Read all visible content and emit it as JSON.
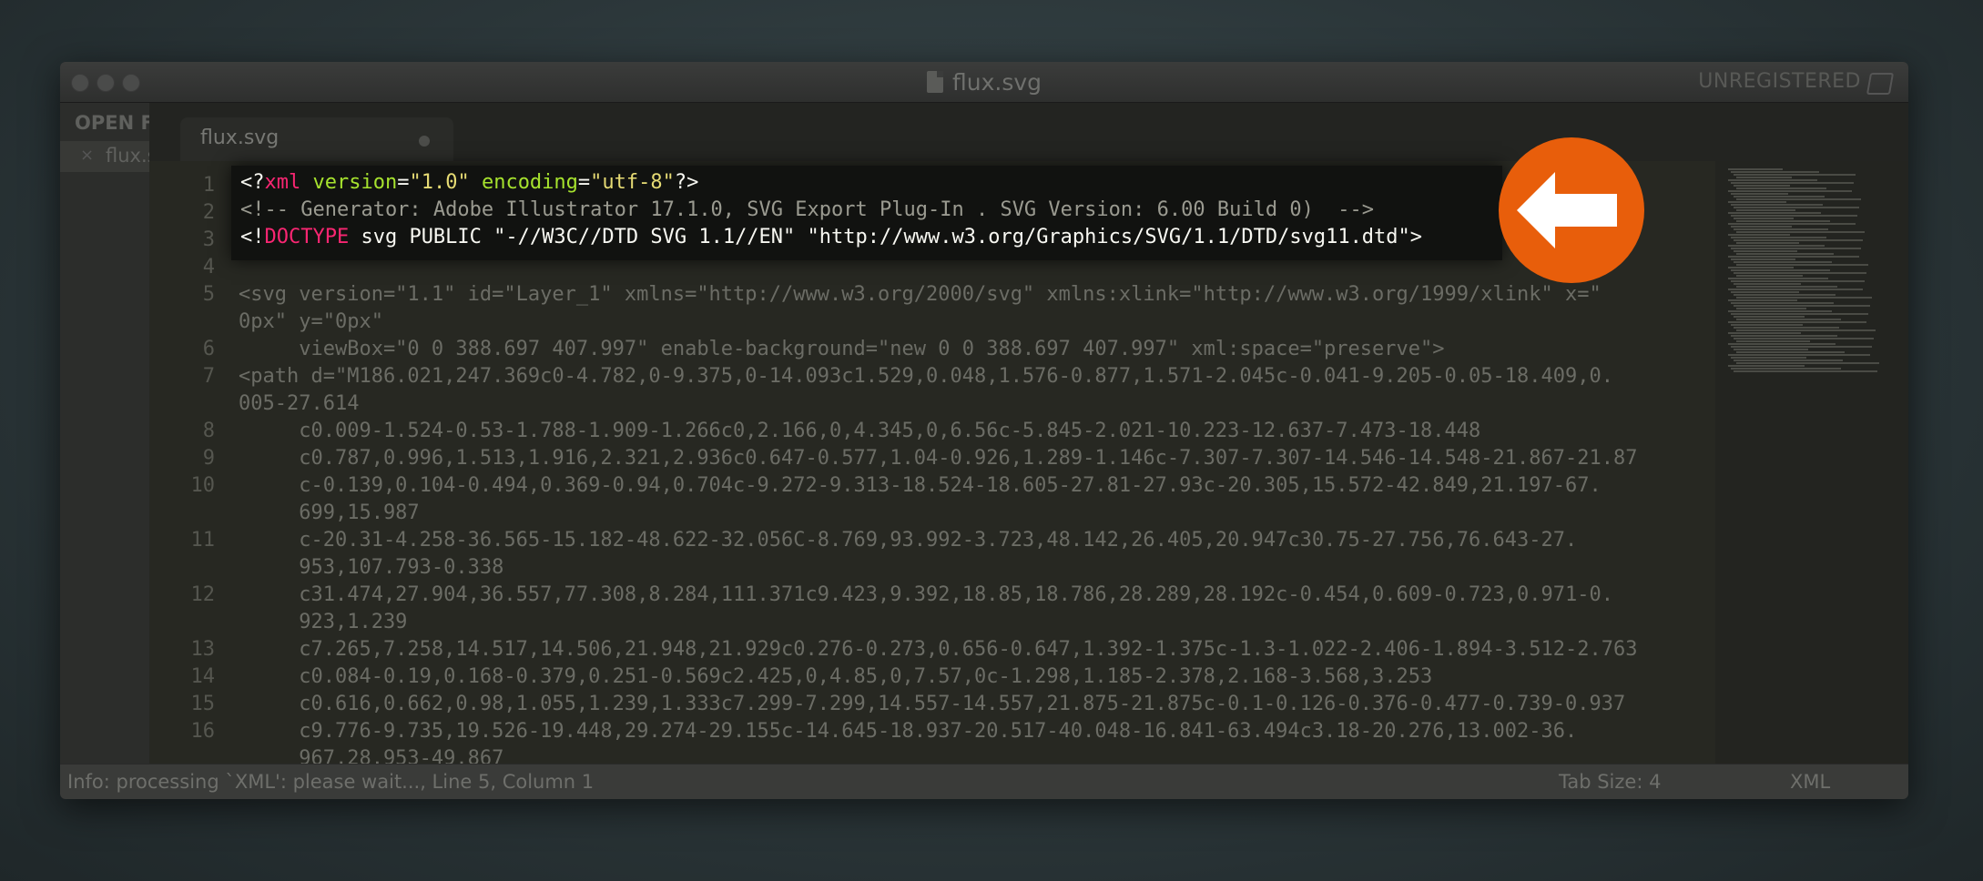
{
  "window": {
    "title": "flux.svg",
    "registration": "UNREGISTERED"
  },
  "sidebar": {
    "header": "OPEN FILES",
    "item_label": "flux.svg"
  },
  "tab": {
    "label": "flux.svg"
  },
  "code_lines": [
    {
      "n": "1",
      "text": "<?xml version=\"1.0\" encoding=\"utf-8\"?>"
    },
    {
      "n": "2",
      "text": "<!-- Generator: Adobe Illustrator 17.1.0, SVG Export Plug-In . SVG Version: 6.00 Build 0)  -->"
    },
    {
      "n": "3",
      "text": "<!DOCTYPE svg PUBLIC \"-//W3C//DTD SVG 1.1//EN\" \"http://www.w3.org/Graphics/SVG/1.1/DTD/svg11.dtd\">"
    },
    {
      "n": "4",
      "text": ""
    },
    {
      "n": "5",
      "text": "<svg version=\"1.1\" id=\"Layer_1\" xmlns=\"http://www.w3.org/2000/svg\" xmlns:xlink=\"http://www.w3.org/1999/xlink\" x=\""
    },
    {
      "n": "",
      "text": "0px\" y=\"0px\""
    },
    {
      "n": "6",
      "text": "     viewBox=\"0 0 388.697 407.997\" enable-background=\"new 0 0 388.697 407.997\" xml:space=\"preserve\">"
    },
    {
      "n": "7",
      "text": "<path d=\"M186.021,247.369c0-4.782,0-9.375,0-14.093c1.529,0.048,1.576-0.877,1.571-2.045c-0.041-9.205-0.05-18.409,0."
    },
    {
      "n": "",
      "text": "005-27.614"
    },
    {
      "n": "8",
      "text": "     c0.009-1.524-0.53-1.788-1.909-1.266c0,2.166,0,4.345,0,6.56c-5.845-2.021-10.223-12.637-7.473-18.448"
    },
    {
      "n": "9",
      "text": "     c0.787,0.996,1.513,1.916,2.321,2.936c0.647-0.577,1.04-0.926,1.289-1.146c-7.307-7.307-14.546-14.548-21.867-21.87"
    },
    {
      "n": "10",
      "text": "     c-0.139,0.104-0.494,0.369-0.94,0.704c-9.272-9.313-18.524-18.605-27.81-27.93c-20.305,15.572-42.849,21.197-67."
    },
    {
      "n": "",
      "text": "     699,15.987"
    },
    {
      "n": "11",
      "text": "     c-20.31-4.258-36.565-15.182-48.622-32.056C-8.769,93.992-3.723,48.142,26.405,20.947c30.75-27.756,76.643-27."
    },
    {
      "n": "",
      "text": "     953,107.793-0.338"
    },
    {
      "n": "12",
      "text": "     c31.474,27.904,36.557,77.308,8.284,111.371c9.423,9.392,18.85,18.786,28.289,28.192c-0.454,0.609-0.723,0.971-0."
    },
    {
      "n": "",
      "text": "     923,1.239"
    },
    {
      "n": "13",
      "text": "     c7.265,7.258,14.517,14.506,21.948,21.929c0.276-0.273,0.656-0.647,1.392-1.375c-1.3-1.022-2.406-1.894-3.512-2.763"
    },
    {
      "n": "14",
      "text": "     c0.084-0.19,0.168-0.379,0.251-0.569c2.425,0,4.85,0,7.57,0c-1.298,1.185-2.378,2.168-3.568,3.253"
    },
    {
      "n": "15",
      "text": "     c0.616,0.662,0.98,1.055,1.239,1.333c7.299-7.299,14.557-14.557,21.875-21.875c-0.1-0.126-0.376-0.477-0.739-0.937"
    },
    {
      "n": "16",
      "text": "     c9.776-9.735,19.526-19.448,29.274-29.155c-14.645-18.937-20.517-40.048-16.841-63.494c3.18-20.276,13.002-36."
    },
    {
      "n": "",
      "text": "     967,28.953-49.867"
    }
  ],
  "highlight": {
    "l1": {
      "a": "<?",
      "b": "xml",
      "c": " ",
      "d": "version",
      "e": "=",
      "f": "\"1.0\"",
      "g": " ",
      "h": "encoding",
      "i": "=",
      "j": "\"utf-8\"",
      "k": "?>"
    },
    "l2": "<!-- Generator: Adobe Illustrator 17.1.0, SVG Export Plug-In . SVG Version: 6.00 Build 0)  -->",
    "l3": {
      "a": "<!",
      "b": "DOCTYPE",
      "c": " svg PUBLIC \"-//W3C//DTD SVG 1.1//EN\" \"http://www.w3.org/Graphics/SVG/1.1/DTD/svg11.dtd\">"
    }
  },
  "status": {
    "left": "Info: processing `XML': please wait..., Line 5, Column 1",
    "tab_size": "Tab Size: 4",
    "syntax": "XML"
  },
  "colors": {
    "accent_badge": "#e85e0b",
    "keyword": "#f92672",
    "attribute": "#a6e22e",
    "string": "#e6db74"
  },
  "icons": {
    "badge": "left-arrow-icon"
  }
}
